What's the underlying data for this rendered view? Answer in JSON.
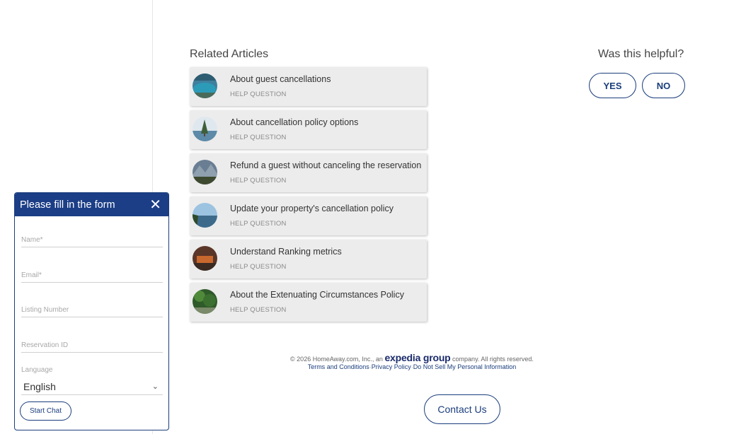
{
  "related": {
    "title": "Related Articles",
    "articles": [
      {
        "title": "About guest cancellations",
        "sub": "HELP QUESTION",
        "thumb": "lake-photo"
      },
      {
        "title": "About cancellation policy options",
        "sub": "HELP QUESTION",
        "thumb": "tree-lake-photo"
      },
      {
        "title": "Refund a guest without canceling the reservation",
        "sub": "HELP QUESTION",
        "thumb": "mountain-photo"
      },
      {
        "title": "Update your property's cancellation policy",
        "sub": "HELP QUESTION",
        "thumb": "lakeshore-photo"
      },
      {
        "title": "Understand Ranking metrics",
        "sub": "HELP QUESTION",
        "thumb": "interior-photo"
      },
      {
        "title": "About the Extenuating Circumstances Policy",
        "sub": "HELP QUESTION",
        "thumb": "forest-photo"
      }
    ]
  },
  "helpful": {
    "question": "Was this helpful?",
    "yes": "YES",
    "no": "NO"
  },
  "footer": {
    "copy_prefix": "© 2026 HomeAway.com, Inc., an",
    "brand": "expedia group",
    "copy_suffix": "company. All rights reserved.",
    "links": [
      "Terms and Conditions",
      "Privacy Policy",
      "Do Not Sell My Personal Information"
    ],
    "contact": "Contact Us"
  },
  "chat": {
    "title": "Please fill in the form",
    "fields": [
      "Name*",
      "Email*",
      "Listing Number",
      "Reservation ID"
    ],
    "language_label": "Language",
    "language_value": "English",
    "start": "Start Chat"
  },
  "colors": {
    "brand_blue": "#1b3e86",
    "card_bg": "#ececec"
  }
}
